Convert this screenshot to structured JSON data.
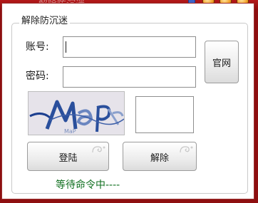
{
  "window": {
    "title": "解除防沉迷"
  },
  "group": {
    "title": "解除防沉迷"
  },
  "form": {
    "account_label": "账号:",
    "account_value": "",
    "password_label": "密码:",
    "password_value": "",
    "captcha_text": "MaP",
    "captcha_value": ""
  },
  "buttons": {
    "official_site": "官网",
    "login": "登陆",
    "remove": "解除"
  },
  "status": {
    "text": "等待命令中----"
  },
  "colors": {
    "frame_red": "#8e0f10",
    "status_green": "#0e6e1e",
    "captcha_ink": "#1c3f8f"
  }
}
